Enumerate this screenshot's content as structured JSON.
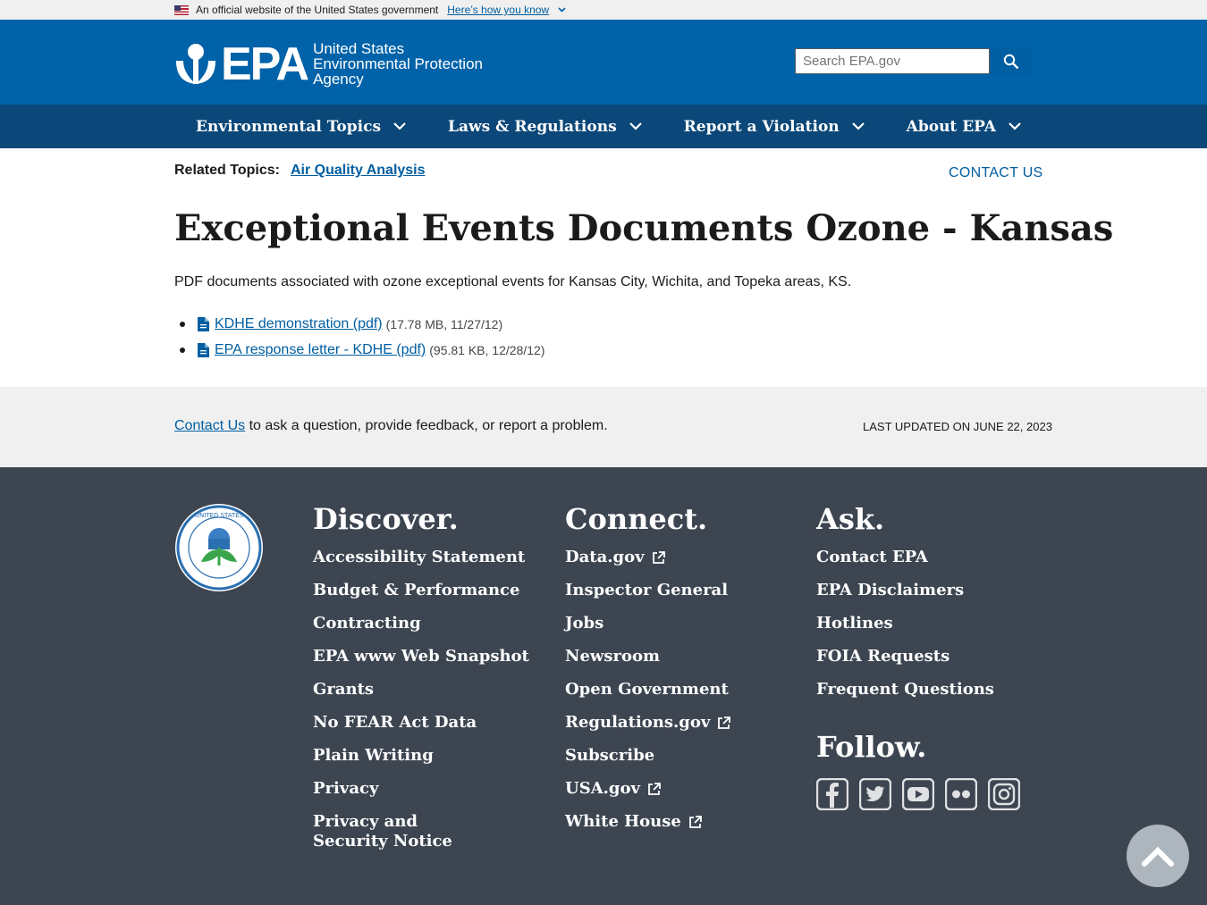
{
  "banner": {
    "text": "An official website of the United States government",
    "how": "Here’s how you know"
  },
  "header": {
    "logo_text": "EPA",
    "agency_line1": "United States",
    "agency_line2": "Environmental Protection",
    "agency_line3": "Agency",
    "search_placeholder": "Search EPA.gov"
  },
  "nav": {
    "items": [
      {
        "label": "Environmental Topics"
      },
      {
        "label": "Laws & Regulations"
      },
      {
        "label": "Report a Violation"
      },
      {
        "label": "About EPA"
      }
    ]
  },
  "page": {
    "related_label": "Related Topics:",
    "related_link": "Air Quality Analysis",
    "contact_us": "CONTACT US",
    "title": "Exceptional Events Documents Ozone - Kansas",
    "description": "PDF documents associated with ozone exceptional events for Kansas City, Wichita, and Topeka areas, KS.",
    "documents": [
      {
        "label": "KDHE demonstration (pdf)",
        "meta": "(17.78 MB, 11/27/12)"
      },
      {
        "label": "EPA response letter - KDHE (pdf)",
        "meta": "(95.81 KB, 12/28/12)"
      }
    ]
  },
  "band": {
    "contact_link": "Contact Us",
    "contact_text": " to ask a question, provide feedback, or report a problem.",
    "last_updated": "LAST UPDATED ON JUNE 22, 2023"
  },
  "footer": {
    "discover": {
      "title": "Discover.",
      "links": [
        "Accessibility Statement",
        "Budget & Performance",
        "Contracting",
        "EPA www Web Snapshot",
        "Grants",
        "No FEAR Act Data",
        "Plain Writing",
        "Privacy",
        "Privacy and Security Notice"
      ]
    },
    "connect": {
      "title": "Connect.",
      "links": [
        "Data.gov",
        "Inspector General",
        "Jobs",
        "Newsroom",
        "Open Government",
        "Regulations.gov",
        "Subscribe",
        "USA.gov",
        "White House"
      ]
    },
    "ask": {
      "title": "Ask.",
      "links": [
        "Contact EPA",
        "EPA Disclaimers",
        "Hotlines",
        "FOIA Requests",
        "Frequent Questions"
      ]
    },
    "follow": {
      "title": "Follow.",
      "icons": [
        "facebook-icon",
        "twitter-icon",
        "youtube-icon",
        "flickr-icon",
        "instagram-icon"
      ]
    }
  },
  "colors": {
    "header": "#0062a8",
    "nav": "#0b4778",
    "link": "#005ea2",
    "footer": "#3d4551",
    "band": "#f0f0f0"
  }
}
